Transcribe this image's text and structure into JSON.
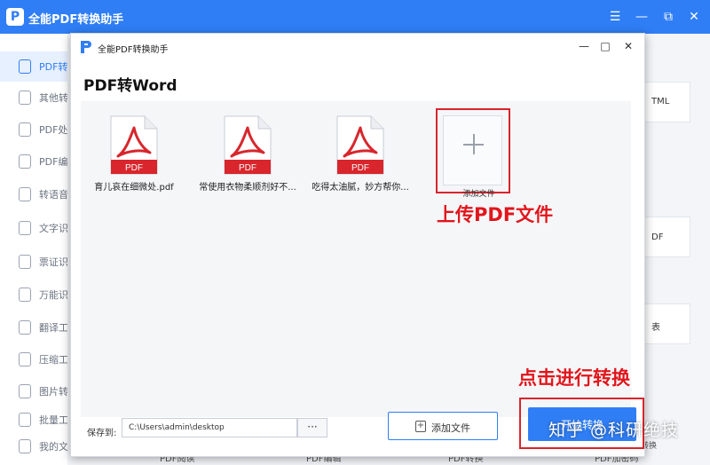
{
  "app": {
    "title": "全能PDF转换助手",
    "logo_letter": "P",
    "controls": [
      "☰",
      "—",
      "⧉",
      "✕"
    ]
  },
  "sidebar": {
    "items": [
      {
        "label": "PDF转换",
        "icon": "pdf-icon",
        "active": true
      },
      {
        "label": "其他转换",
        "icon": "convert-icon"
      },
      {
        "label": "PDF处理",
        "icon": "pdf-process-icon"
      },
      {
        "label": "PDF编辑",
        "icon": "pdf-edit-icon"
      },
      {
        "label": "转语音工具",
        "icon": "voice-icon"
      },
      {
        "label": "文字识别",
        "icon": "text-recognition-icon"
      },
      {
        "label": "票证识别",
        "icon": "ticket-icon"
      },
      {
        "label": "万能识别",
        "icon": "universal-icon"
      },
      {
        "label": "翻译工具",
        "icon": "translate-icon"
      },
      {
        "label": "压缩工具",
        "icon": "compress-icon"
      },
      {
        "label": "图片转换",
        "icon": "image-icon"
      },
      {
        "label": "批量工具",
        "icon": "batch-icon"
      },
      {
        "label": "我的文件",
        "icon": "folder-icon"
      }
    ]
  },
  "background": {
    "cards": [
      "TML",
      "DF",
      "表"
    ],
    "bottom_items": [
      "PDF阅读",
      "PDF编辑",
      "PDF转换",
      "PDF加密码"
    ],
    "phone_label": "手机转换"
  },
  "dialog": {
    "title": "全能PDF转换助手",
    "heading": "PDF转Word",
    "controls": [
      "—",
      "□",
      "✕"
    ],
    "files": [
      {
        "name": "育儿哀在细微处.pdf",
        "badge": "PDF"
      },
      {
        "name": "常使用衣物柔顺剂好不...",
        "badge": "PDF"
      },
      {
        "name": "吃得太油腻，妙方帮你...",
        "badge": "PDF"
      }
    ],
    "add_tile_label": "添加文件",
    "save_label": "保存到:",
    "save_path": "C:\\Users\\admin\\desktop",
    "browse_label": "···",
    "add_file_button": "添加文件",
    "add_file_icon_char": "+",
    "start_button": "开始转换"
  },
  "annotations": {
    "upload": "上传PDF文件",
    "convert": "点击进行转换"
  },
  "watermark": "知乎 @科研绝技",
  "colors": {
    "accent": "#2f7ef5",
    "annotation": "#e0161c",
    "pdf_badge": "#d8262c"
  }
}
